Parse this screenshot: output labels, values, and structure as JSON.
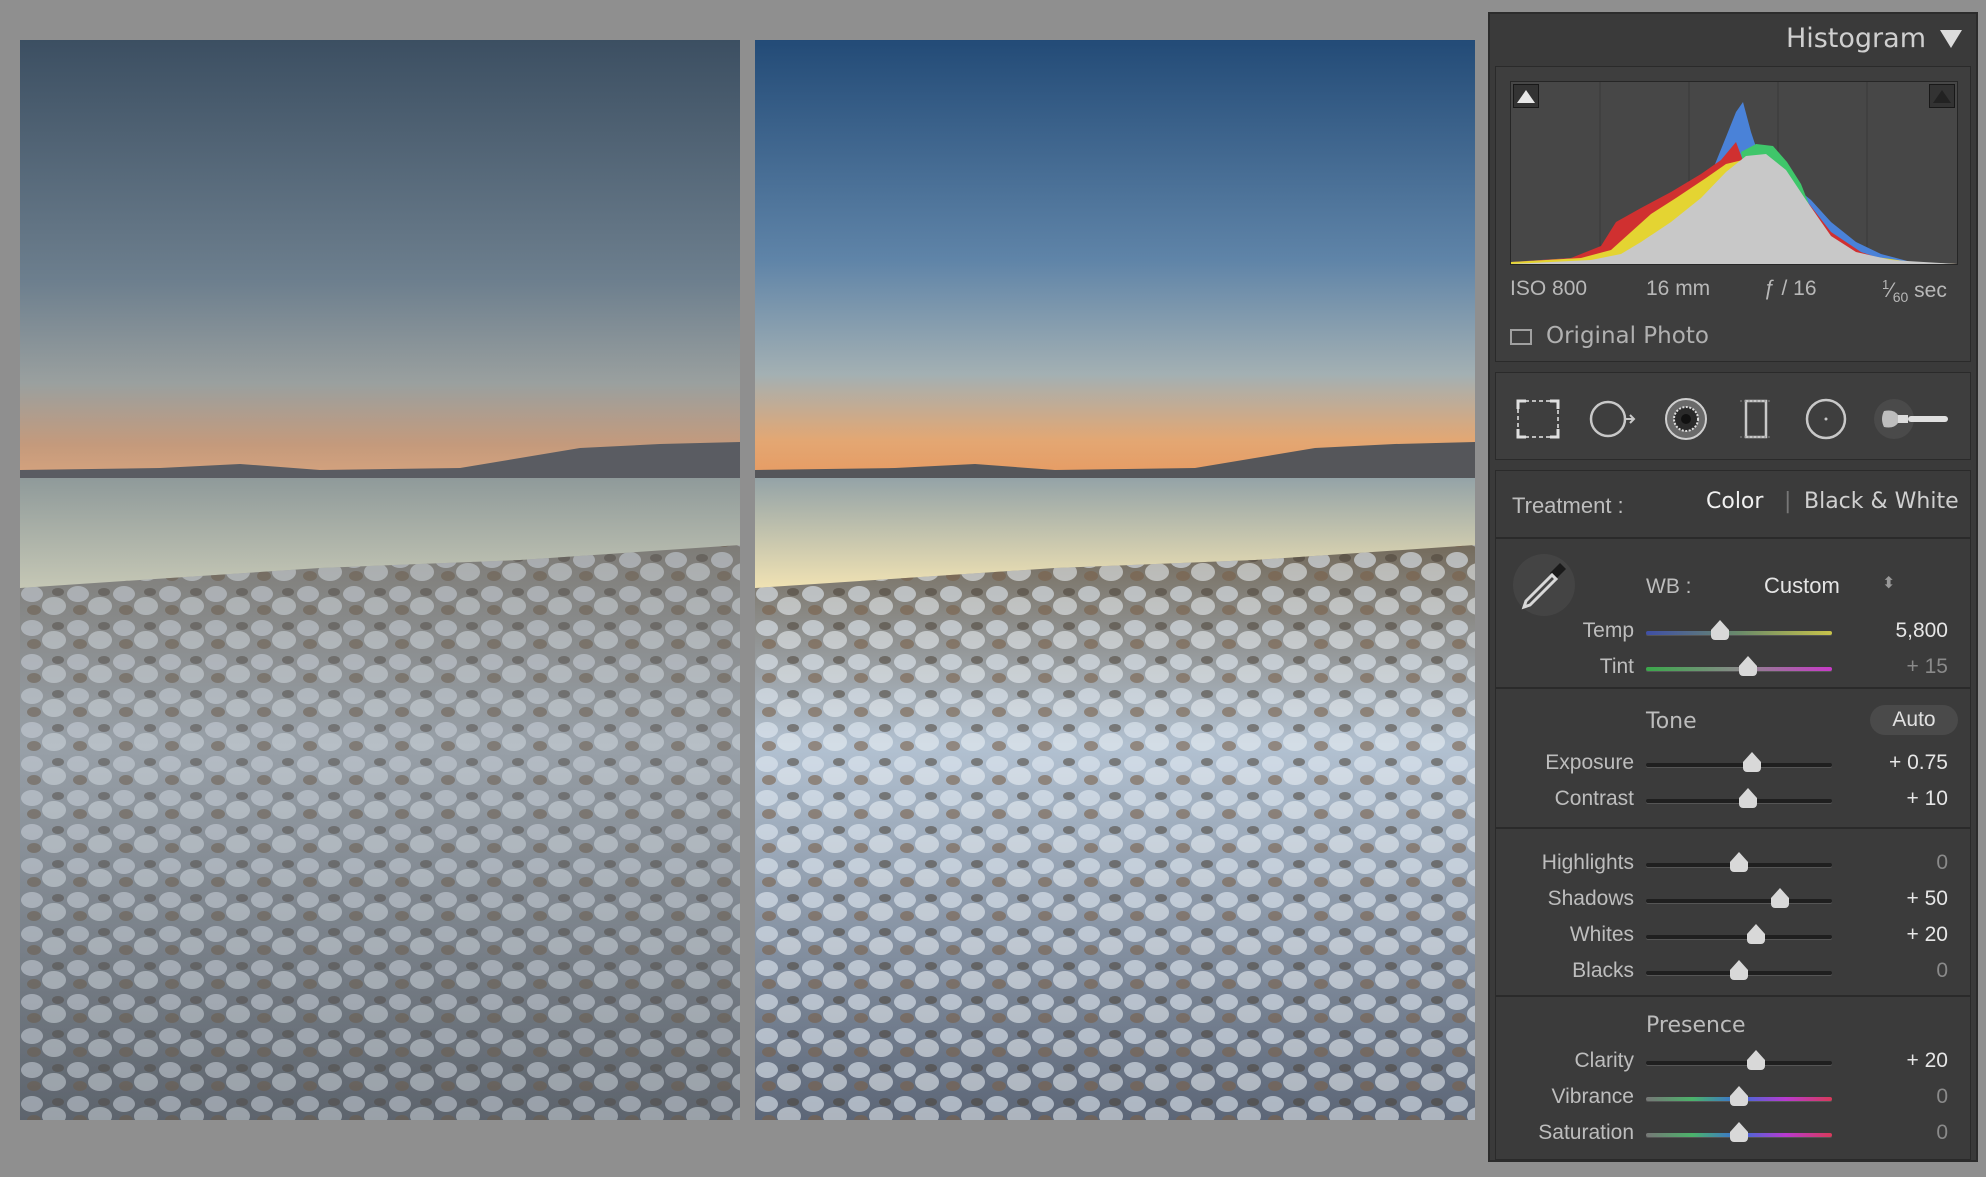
{
  "panel": {
    "title": "Histogram",
    "exif": {
      "iso": "ISO 800",
      "focal": "16 mm",
      "aperture": "ƒ / 16",
      "shutter_num": "1",
      "shutter_den": "60",
      "shutter_unit": "sec"
    },
    "original_photo_label": "Original Photo",
    "tools": [
      "crop-overlay-icon",
      "spot-removal-icon",
      "red-eye-icon",
      "graduated-filter-icon",
      "radial-filter-icon",
      "adjustment-brush-icon"
    ]
  },
  "basic": {
    "treatment_label": "Treatment :",
    "treatment_color": "Color",
    "treatment_separator": "|",
    "treatment_bw": "Black & White",
    "wb_label": "WB :",
    "wb_value": "Custom",
    "wb_arrows": "⬍",
    "tone_title": "Tone",
    "auto_label": "Auto",
    "presence_title": "Presence",
    "sliders": {
      "temp": {
        "label": "Temp",
        "value": "5,800",
        "pos": 0.4
      },
      "tint": {
        "label": "Tint",
        "value": "+ 15",
        "pos": 0.55
      },
      "exposure": {
        "label": "Exposure",
        "value": "+ 0.75",
        "pos": 0.57
      },
      "contrast": {
        "label": "Contrast",
        "value": "+ 10",
        "pos": 0.55
      },
      "highlights": {
        "label": "Highlights",
        "value": "0",
        "pos": 0.5
      },
      "shadows": {
        "label": "Shadows",
        "value": "+ 50",
        "pos": 0.72
      },
      "whites": {
        "label": "Whites",
        "value": "+ 20",
        "pos": 0.59
      },
      "blacks": {
        "label": "Blacks",
        "value": "0",
        "pos": 0.5
      },
      "clarity": {
        "label": "Clarity",
        "value": "+ 20",
        "pos": 0.59
      },
      "vibrance": {
        "label": "Vibrance",
        "value": "0",
        "pos": 0.5
      },
      "saturation": {
        "label": "Saturation",
        "value": "0",
        "pos": 0.5
      }
    }
  },
  "colors": {
    "panel_bg": "#3a3a3a",
    "sky_before_top": "#3c4f62",
    "sky_after_top": "#274f7a",
    "horizon_glow": "#e5a470"
  }
}
